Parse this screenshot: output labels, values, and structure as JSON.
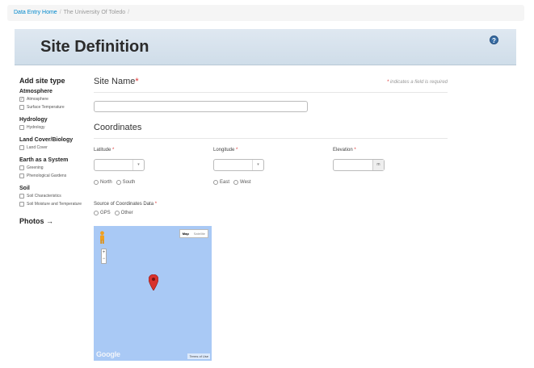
{
  "breadcrumb": {
    "home": "Data Entry Home",
    "separator": "/",
    "current": "The University Of Toledo",
    "trailing_separator": "/"
  },
  "banner": {
    "title": "Site Definition",
    "help_icon": "?"
  },
  "sidebar": {
    "title": "Add site type",
    "groups": [
      {
        "title": "Atmosphere",
        "items": [
          {
            "label": "Atmosphere",
            "checked": true
          },
          {
            "label": "Surface Temperature",
            "checked": false
          }
        ]
      },
      {
        "title": "Hydrology",
        "items": [
          {
            "label": "Hydrology",
            "checked": false
          }
        ]
      },
      {
        "title": "Land Cover/Biology",
        "items": [
          {
            "label": "Land Cover",
            "checked": false
          }
        ]
      },
      {
        "title": "Earth as a System",
        "items": [
          {
            "label": "Greening",
            "checked": false
          },
          {
            "label": "Phenological Gardens",
            "checked": false
          }
        ]
      },
      {
        "title": "Soil",
        "items": [
          {
            "label": "Soil Characteristics",
            "checked": false
          },
          {
            "label": "Soil Moisture and Temperature",
            "checked": false
          }
        ]
      }
    ],
    "photos_link": "Photos →"
  },
  "form": {
    "site_name_label": "Site Name",
    "required_marker": "*",
    "required_note": "indicates a field is required",
    "site_name_value": "",
    "coordinates_title": "Coordinates",
    "latitude_label": "Latitude",
    "latitude_value": "",
    "longitude_label": "Longitude",
    "longitude_value": "",
    "elevation_label": "Elevation",
    "elevation_value": "",
    "elevation_unit": "m",
    "lat_options": [
      "North",
      "South"
    ],
    "lon_options": [
      "East",
      "West"
    ],
    "source_label": "Source of Coordinates Data",
    "source_options": [
      "GPS",
      "Other"
    ]
  },
  "map": {
    "maptype_active": "Map",
    "maptype_inactive": "Satellite",
    "zoom_in": "+",
    "zoom_out": "−",
    "logo": "Google",
    "terms": "Terms of Use",
    "water_color": "#a9c9f5",
    "marker_color": "#d8322d"
  },
  "colors": {
    "link": "#0088cc",
    "required": "#d33",
    "banner_top": "#dfe8f1",
    "banner_bottom": "#cfdde9"
  }
}
